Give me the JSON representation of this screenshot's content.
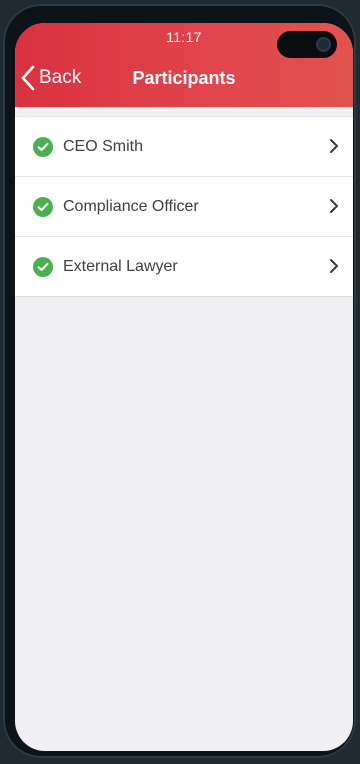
{
  "status_bar": {
    "time": "11:17"
  },
  "nav": {
    "back_label": "Back",
    "title": "Participants"
  },
  "participants": [
    {
      "name": "CEO Smith",
      "status": "checked"
    },
    {
      "name": "Compliance Officer",
      "status": "checked"
    },
    {
      "name": "External Lawyer",
      "status": "checked"
    }
  ],
  "colors": {
    "header": "#dd3c45",
    "check": "#4caf50",
    "background": "#efeff4"
  }
}
